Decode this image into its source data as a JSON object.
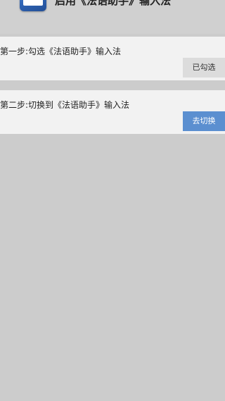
{
  "header": {
    "title": "启用《法语助手》输入法",
    "icon": "app-icon"
  },
  "steps": [
    {
      "label": "第一步:勾选《法语助手》输入法",
      "button_label": "已勾选",
      "button_color": "#dcdcdc"
    },
    {
      "label": "第二步:切换到《法语助手》输入法",
      "button_label": "去切换",
      "button_color": "#5b8fd0"
    }
  ],
  "colors": {
    "background": "#cccccc",
    "card": "#f2f2f2",
    "accent": "#5b8fd0"
  }
}
